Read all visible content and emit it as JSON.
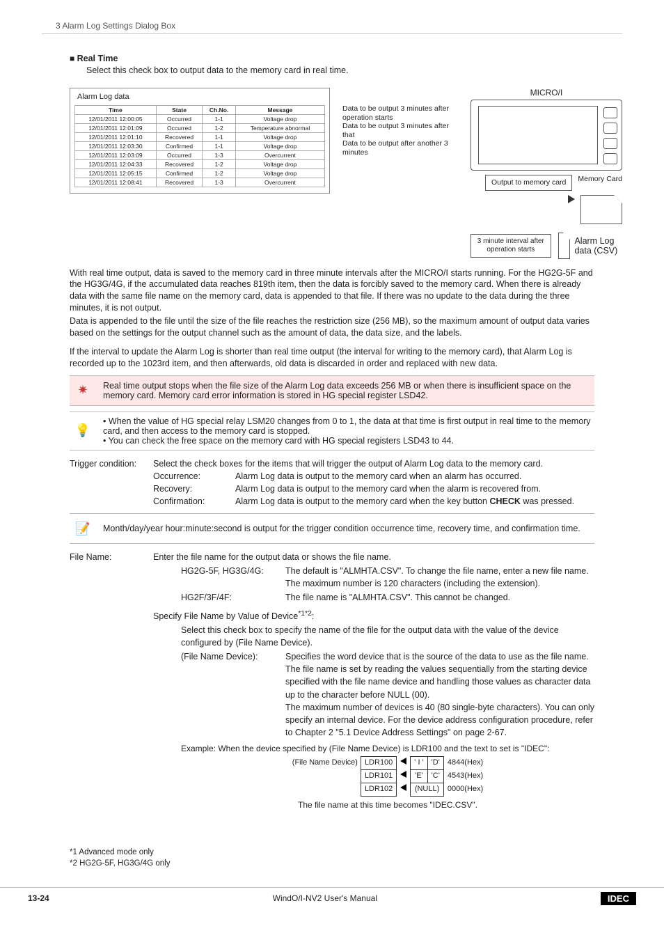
{
  "header": {
    "breadcrumb": "3 Alarm Log Settings Dialog Box"
  },
  "section": {
    "title": "Real Time",
    "desc": "Select this check box to output data to the memory card in real time."
  },
  "diagram": {
    "card_title": "Alarm Log data",
    "headers": [
      "Time",
      "State",
      "Ch.No.",
      "Message"
    ],
    "rows": [
      {
        "t": "12/01/2011 12:00:05",
        "s": "Occurred",
        "c": "1-1",
        "m": "Voltage drop"
      },
      {
        "t": "12/01/2011 12:01:09",
        "s": "Occurred",
        "c": "1-2",
        "m": "Temperature abnormal"
      },
      {
        "t": "12/01/2011 12:01:10",
        "s": "Recovered",
        "c": "1-1",
        "m": "Voltage drop"
      },
      {
        "t": "12/01/2011 12:03:30",
        "s": "Confirmed",
        "c": "1-1",
        "m": "Voltage drop"
      },
      {
        "t": "12/01/2011 12:03:09",
        "s": "Occurred",
        "c": "1-3",
        "m": "Overcurrent"
      },
      {
        "t": "12/01/2011 12:04:33",
        "s": "Recovered",
        "c": "1-2",
        "m": "Voltage drop"
      },
      {
        "t": "12/01/2011 12:05:15",
        "s": "Confirmed",
        "c": "1-2",
        "m": "Voltage drop"
      },
      {
        "t": "12/01/2011 12:08:41",
        "s": "Recovered",
        "c": "1-3",
        "m": "Overcurrent"
      }
    ],
    "brace1": "Data to be output 3 minutes after operation starts",
    "brace2": "Data to be output 3 minutes after that",
    "brace3": "Data to be output after another 3 minutes",
    "micro_title": "MICRO/I",
    "output_label": "Output to memory card",
    "mcard_label": "Memory Card",
    "interval_label": "3 minute interval after operation starts",
    "csv_label": "Alarm Log data (CSV)"
  },
  "paras": {
    "p1": "With real time output, data is saved to the memory card in three minute intervals after the MICRO/I starts running. For the HG2G-5F and the HG3G/4G, if the accumulated data reaches 819th item, then the data is forcibly saved to the memory card. When there is already data with the same file name on the memory card, data is appended to that file. If there was no update to the data during the three minutes, it is not output.",
    "p2": "Data is appended to the file until the size of the file reaches the restriction size (256 MB), so the maximum amount of output data varies based on the settings for the output channel such as the amount of data, the data size, and the labels.",
    "p3": "If the interval to update the Alarm Log is shorter than real time output (the interval for writing to the memory card), that Alarm Log is recorded up to the 1023rd item, and then afterwards, old data is discarded in order and replaced with new data."
  },
  "callouts": {
    "warn": "Real time output stops when the file size of the Alarm Log data exceeds 256 MB or when there is insufficient space on the memory card. Memory card error information is stored in HG special register LSD42.",
    "tip1": "When the value of HG special relay LSM20 changes from 0 to 1, the data at that time is first output in real time to the memory card, and then access to the memory card is stopped.",
    "tip2": "You can check the free space on the memory card with HG special registers LSD43 to 44.",
    "note": "Month/day/year hour:minute:second is output for the trigger condition occurrence time, recovery time, and confirmation time."
  },
  "trigger": {
    "label": "Trigger condition:",
    "intro": "Select the check boxes for the items that will trigger the output of Alarm Log data to the memory card.",
    "occ_l": "Occurrence:",
    "occ_t": "Alarm Log data is output to the memory card when an alarm has occurred.",
    "rec_l": "Recovery:",
    "rec_t": "Alarm Log data is output to the memory card when the alarm is recovered from.",
    "con_l": "Confirmation:",
    "con_pre": "Alarm Log data is output to the memory card when the key button ",
    "con_bold": "CHECK",
    "con_post": " was pressed."
  },
  "filename": {
    "label": "File Name:",
    "intro": "Enter the file name for the output data or shows the file name.",
    "m1_l": "HG2G-5F, HG3G/4G:",
    "m1_t": "The default is \"ALMHTA.CSV\". To change the file name, enter a new file name. The maximum number is 120 characters (including the extension).",
    "m2_l": "HG2F/3F/4F:",
    "m2_t": "The file name is \"ALMHTA.CSV\". This cannot be changed.",
    "spec_header": "Specify File Name by Value of Device",
    "spec_sup": "*1*2",
    "spec_colon": ":",
    "spec_desc": "Select this check box to specify the name of the file for the output data with the value of the device configured by (File Name Device).",
    "fnd_l": "(File Name Device):",
    "fnd_t1": "Specifies the word device that is the source of the data to use as the file name. The file name is set by reading the values sequentially from the starting device specified with the file name device and handling those values as character data up to the character before NULL (00).",
    "fnd_t2": "The maximum number of devices is 40 (80 single-byte characters). You can only specify an internal device. For the device address configuration procedure, refer to Chapter 2 \"5.1 Device Address Settings\" on page 2-67.",
    "example_intro": "Example: When the device specified by (File Name Device) is LDR100 and the text to set is \"IDEC\":",
    "fnd_prefix": "(File Name Device)",
    "ldr": [
      {
        "d": "LDR100",
        "c1": "' I '",
        "c2": "'D'",
        "h": "4844(Hex)"
      },
      {
        "d": "LDR101",
        "c1": "'E'",
        "c2": "'C'",
        "h": "4543(Hex)"
      },
      {
        "d": "LDR102",
        "c1": "(NULL)",
        "c2": "",
        "h": "0000(Hex)"
      }
    ],
    "becomes": "The file name at this time becomes \"IDEC.CSV\"."
  },
  "footnotes": {
    "f1": "*1  Advanced mode only",
    "f2": "*2  HG2G-5F, HG3G/4G only"
  },
  "footer": {
    "page": "13-24",
    "manual": "WindO/I-NV2 User's Manual",
    "brand": "IDEC"
  }
}
